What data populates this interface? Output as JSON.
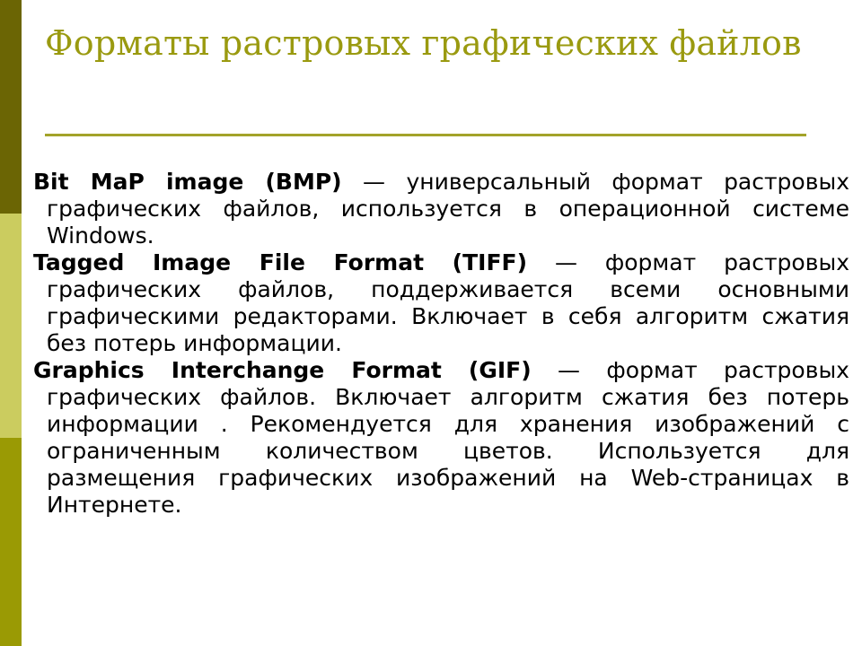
{
  "slide": {
    "title": "Форматы растровых графических файлов",
    "title_color": "#9A9A10",
    "rule_color": "#A3A32A",
    "background_color": "#FFFFFF",
    "body_text_color": "#000000"
  },
  "side_strip": {
    "band_top_color": "#6B6504",
    "band_middle_color": "#CBCC5F",
    "band_bottom_color": "#9A9A04"
  },
  "body": {
    "paragraphs": [
      {
        "term": "Bit MaP image (BMP)",
        "separator": " — ",
        "description": "универсальный формат растровых графических файлов, используется в операционной системе Windows."
      },
      {
        "term": "Tagged Image File Format (TIFF)",
        "separator": " — ",
        "description": "формат растровых графических файлов, поддерживается всеми основными графическими редакторами. Включает в себя алгоритм сжатия без потерь информации."
      },
      {
        "term": "Graphics Interchange Format (GIF)",
        "separator": " — ",
        "description": "формат растровых графических файлов. Включает алгоритм сжатия без потерь информации . Рекомендуется для хранения изображений с ограниченным количеством цветов. Используется для размещения графических изображений на Web-страницах в Интернете."
      }
    ]
  }
}
